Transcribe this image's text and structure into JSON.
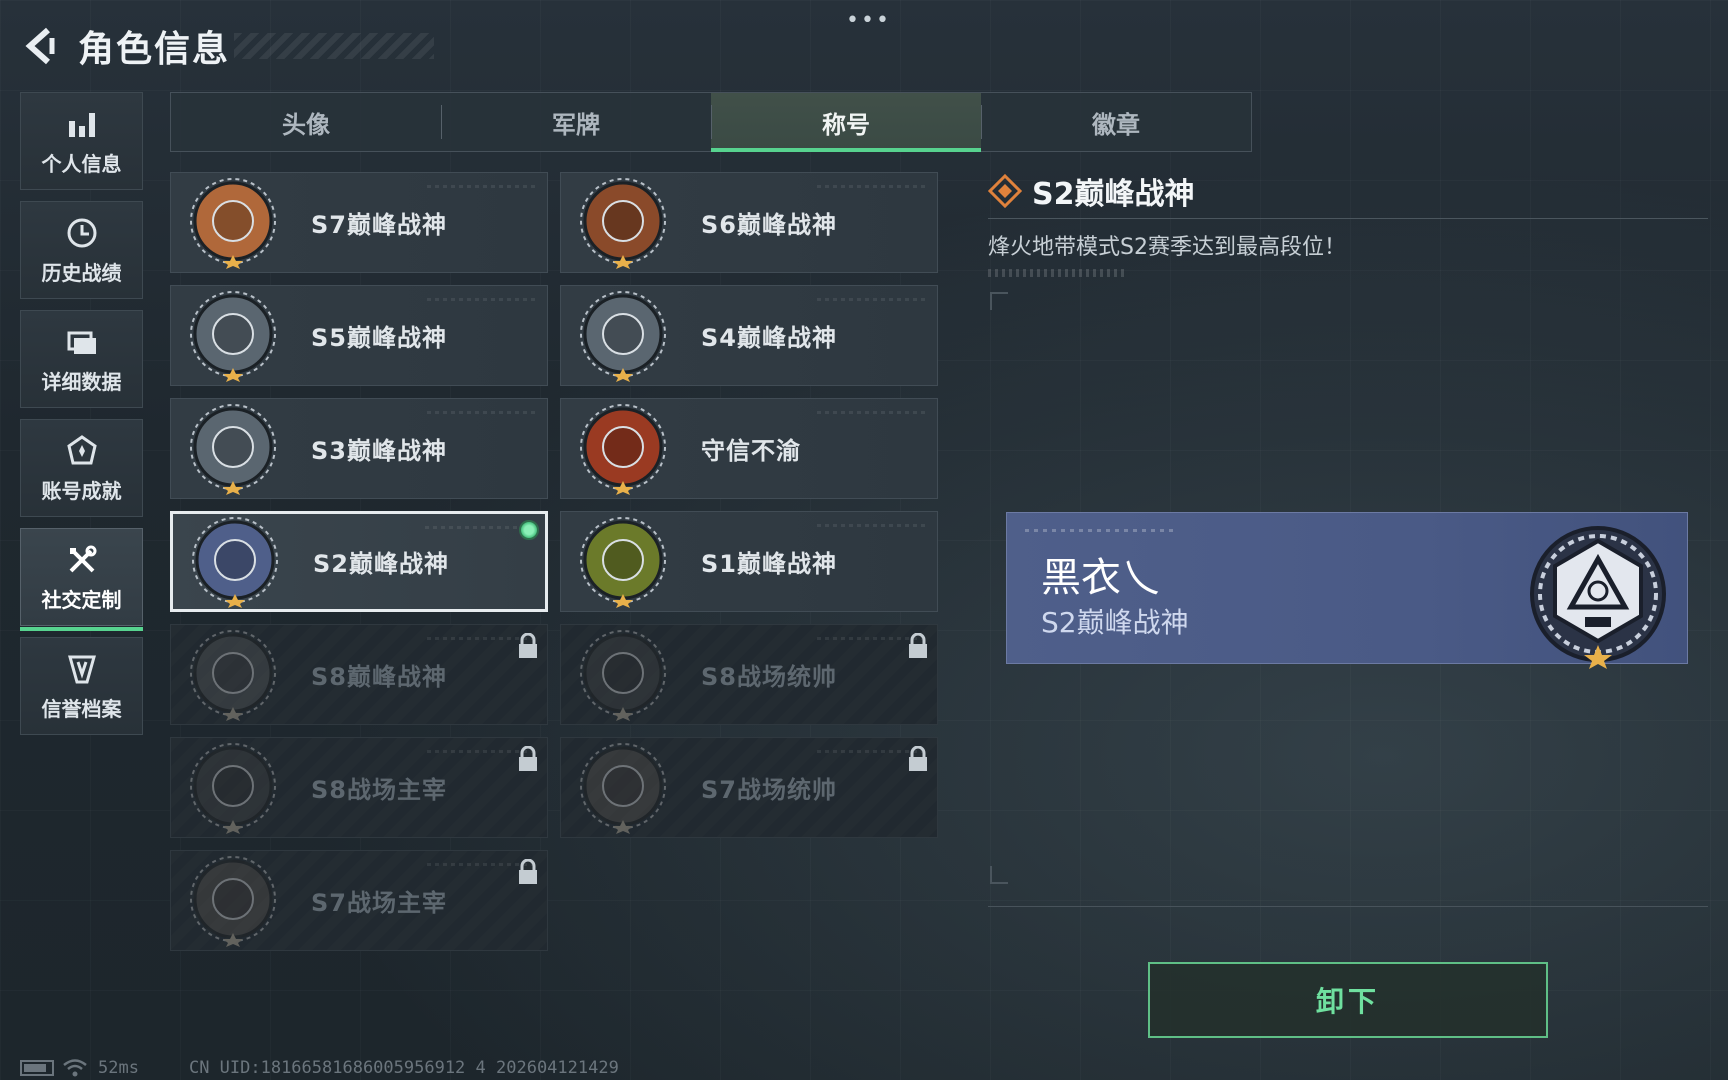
{
  "header": {
    "title": "角色信息",
    "more": "•••"
  },
  "side_nav": [
    {
      "label": "个人信息",
      "icon": "bar-chart-icon",
      "active": false
    },
    {
      "label": "历史战绩",
      "icon": "history-icon",
      "active": false
    },
    {
      "label": "详细数据",
      "icon": "folder-icon",
      "active": false
    },
    {
      "label": "账号成就",
      "icon": "achievement-icon",
      "active": false
    },
    {
      "label": "社交定制",
      "icon": "tools-icon",
      "active": true
    },
    {
      "label": "信誉档案",
      "icon": "shield-icon",
      "active": false
    }
  ],
  "tabs": [
    {
      "label": "头像",
      "active": false
    },
    {
      "label": "军牌",
      "active": false
    },
    {
      "label": "称号",
      "active": true
    },
    {
      "label": "徽章",
      "active": false
    }
  ],
  "titles": [
    {
      "name": "S7巅峰战神",
      "state": "unlocked",
      "badge": "crossbow",
      "color": "#b0683a"
    },
    {
      "name": "S6巅峰战神",
      "state": "unlocked",
      "badge": "t-shield",
      "color": "#8a4a2a"
    },
    {
      "name": "S5巅峰战神",
      "state": "unlocked",
      "badge": "skull-diver",
      "color": "#5a6670"
    },
    {
      "name": "S4巅峰战神",
      "state": "unlocked",
      "badge": "helmet",
      "color": "#5a6670"
    },
    {
      "name": "S3巅峰战神",
      "state": "unlocked",
      "badge": "globe",
      "color": "#5a6670"
    },
    {
      "name": "守信不渝",
      "state": "unlocked",
      "badge": "scales",
      "color": "#9a3a22"
    },
    {
      "name": "S2巅峰战神",
      "state": "selected",
      "badge": "hex-emblem",
      "color": "#4f5f8a"
    },
    {
      "name": "S1巅峰战神",
      "state": "unlocked",
      "badge": "crocodile",
      "color": "#6b7a2a"
    },
    {
      "name": "S8巅峰战神",
      "state": "locked",
      "badge": "stripes",
      "color": "#4a5660"
    },
    {
      "name": "S8战场统帅",
      "state": "locked",
      "badge": "tank",
      "color": "#3a4248"
    },
    {
      "name": "S8战场主宰",
      "state": "locked",
      "badge": "building",
      "color": "#3a4248"
    },
    {
      "name": "S7战场统帅",
      "state": "locked",
      "badge": "vehicle",
      "color": "#6a4a3a"
    },
    {
      "name": "S7战场主宰",
      "state": "locked",
      "badge": "soldier",
      "color": "#6a4a3a"
    }
  ],
  "detail": {
    "title": "S2巅峰战神",
    "description": "烽火地带模式S2赛季达到最高段位！"
  },
  "nameplate": {
    "player_name": "黑衣乀",
    "title": "S2巅峰战神"
  },
  "actions": {
    "unequip_label": "卸下"
  },
  "status": {
    "ping": "52ms",
    "uid": "CN UID:18166581686005956912 4 202604121429"
  },
  "colors": {
    "accent_green": "#57d38f",
    "plate_blue": "#4f5f8a",
    "diamond_orange": "#e0823c"
  }
}
